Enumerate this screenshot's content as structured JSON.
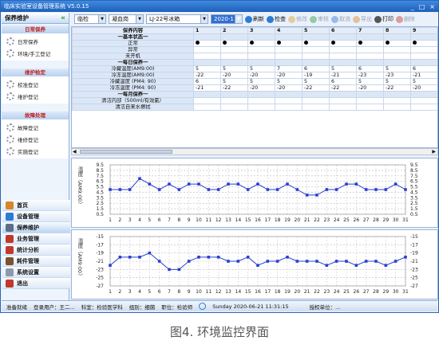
{
  "window": {
    "title": "临床实验室设备管理系统 V5.0.15",
    "controls": [
      "_",
      "□",
      "×"
    ]
  },
  "sidebar": {
    "header": "保养维护",
    "groups": [
      {
        "title": "日常保养",
        "items": [
          "日常保养",
          "环境/手工登记"
        ]
      },
      {
        "title": "维护检定",
        "items": [
          "校准登记",
          "维护登记"
        ]
      },
      {
        "title": "故障处理",
        "items": [
          "故障登记",
          "维修登记",
          "实施登记"
        ]
      }
    ],
    "nav": [
      {
        "label": "首页",
        "color": "#d9862a"
      },
      {
        "label": "设备管理",
        "color": "#2d7bd3"
      },
      {
        "label": "保养维护",
        "color": "#5b6e86"
      },
      {
        "label": "业务管理",
        "color": "#c0392b"
      },
      {
        "label": "统计分析",
        "color": "#c0392b"
      },
      {
        "label": "耗件管理",
        "color": "#7a5230"
      },
      {
        "label": "系统设置",
        "color": "#8e9aaa"
      },
      {
        "label": "退出",
        "color": "#c0392b"
      }
    ]
  },
  "toolbar": {
    "dept": "临检",
    "position": "凝血岗",
    "device": "LJ-22号冰箱",
    "month": "2020-1",
    "buttons": [
      {
        "label": "刷新",
        "color": "#2d7bd3",
        "disabled": false
      },
      {
        "label": "检查",
        "color": "#2d7bd3",
        "disabled": false
      },
      {
        "label": "修改",
        "color": "#d9a02a",
        "disabled": true
      },
      {
        "label": "审核",
        "color": "#2d9b3c",
        "disabled": true
      },
      {
        "label": "取消",
        "color": "#2d7bd3",
        "disabled": true
      },
      {
        "label": "导出",
        "color": "#d9862a",
        "disabled": true
      },
      {
        "label": "打印",
        "color": "#555555",
        "disabled": false
      },
      {
        "label": "删除",
        "color": "#c0392b",
        "disabled": true
      }
    ]
  },
  "table": {
    "header": "保养内容",
    "days": [
      "1",
      "2",
      "3",
      "4",
      "5",
      "6",
      "7",
      "8",
      "9"
    ],
    "rows": [
      {
        "type": "section",
        "label": "一基本状态一"
      },
      {
        "type": "row",
        "label": "正常",
        "cells": [
          "●",
          "●",
          "●",
          "●",
          "●",
          "●",
          "●",
          "●",
          "●"
        ]
      },
      {
        "type": "row",
        "label": "异常",
        "cells": [
          "",
          "",
          "",
          "",
          "",
          "",
          "",
          "",
          ""
        ]
      },
      {
        "type": "row",
        "label": "未开机",
        "cells": [
          "",
          "",
          "",
          "",
          "",
          "",
          "",
          "",
          ""
        ]
      },
      {
        "type": "section",
        "label": "一每日保养一"
      },
      {
        "type": "row",
        "label": "冷藏温度(AM9:00)",
        "cells": [
          "5",
          "5",
          "5",
          "7",
          "6",
          "5",
          "6",
          "5",
          "6"
        ]
      },
      {
        "type": "row",
        "label": "冷冻温度(AM9:00)",
        "cells": [
          "-22",
          "-20",
          "-20",
          "-20",
          "-19",
          "-21",
          "-23",
          "-23",
          "-21"
        ]
      },
      {
        "type": "row",
        "label": "冷藏温度 (PM4: 90)",
        "cells": [
          "6",
          "5",
          "5",
          "5",
          "5",
          "6",
          "5",
          "5",
          "5"
        ]
      },
      {
        "type": "row",
        "label": "冷冻温度 (PM4: 90)",
        "cells": [
          "-21",
          "-22",
          "-20",
          "-20",
          "-22",
          "-22",
          "-20",
          "-22",
          "-20"
        ]
      },
      {
        "type": "section",
        "label": "一每月保养一"
      },
      {
        "type": "row",
        "label": "清洁内部（500ml/有效氯）",
        "cells": [
          "",
          "",
          "",
          "",
          "",
          "",
          "",
          "",
          ""
        ]
      },
      {
        "type": "row",
        "label": "清洁自来水擦拭",
        "cells": [
          "",
          "",
          "",
          "",
          "",
          "",
          "",
          "",
          ""
        ]
      }
    ]
  },
  "chart_data": [
    {
      "type": "line",
      "ylabel": "温度（AM9:00）",
      "x": [
        1,
        2,
        3,
        4,
        5,
        6,
        7,
        8,
        9,
        10,
        11,
        12,
        13,
        14,
        15,
        16,
        17,
        18,
        19,
        20,
        21,
        22,
        23,
        24,
        25,
        26,
        27,
        28,
        29,
        30,
        31
      ],
      "yticks": [
        "9.5",
        "8.5",
        "7.5",
        "6.5",
        "5.5",
        "4.5",
        "3.5",
        "2.5",
        "1.5",
        "0.5"
      ],
      "ylim": [
        0.5,
        9.5
      ],
      "series": [
        {
          "color": "#2a3fd0",
          "values": [
            5,
            5,
            5,
            7,
            6,
            5,
            6,
            5,
            6,
            6,
            5,
            5,
            6,
            6,
            5,
            6,
            5,
            5,
            6,
            5,
            4,
            4,
            5,
            5,
            6,
            6,
            5,
            5,
            5,
            6,
            5
          ]
        }
      ]
    },
    {
      "type": "line",
      "ylabel": "温度（AM9:00）",
      "x": [
        1,
        2,
        3,
        4,
        5,
        6,
        7,
        8,
        9,
        10,
        11,
        12,
        13,
        14,
        15,
        16,
        17,
        18,
        19,
        20,
        21,
        22,
        23,
        24,
        25,
        26,
        27,
        28,
        29,
        30,
        31
      ],
      "yticks": [
        "-15",
        "-17",
        "-19",
        "-21",
        "-23",
        "-25",
        "-27"
      ],
      "ylim": [
        -27,
        -15
      ],
      "series": [
        {
          "color": "#2a3fd0",
          "values": [
            -22,
            -20,
            -20,
            -20,
            -19,
            -21,
            -23,
            -23,
            -21,
            -20,
            -20,
            -20,
            -21,
            -21,
            -20,
            -22,
            -21,
            -21,
            -20,
            -21,
            -21,
            -21,
            -22,
            -21,
            -21,
            -22,
            -21,
            -21,
            -22,
            -21,
            -20
          ]
        }
      ]
    }
  ],
  "status": {
    "ready": "准备就绪",
    "user": "登录用户：王二...",
    "dept": "科室：检验医学科",
    "group": "组别：细菌",
    "title": "职位：检验师",
    "datetime": "Sunday 2020-06-21 11:31:15",
    "license": "授权单位：..."
  },
  "caption": "图4. 环境监控界面"
}
